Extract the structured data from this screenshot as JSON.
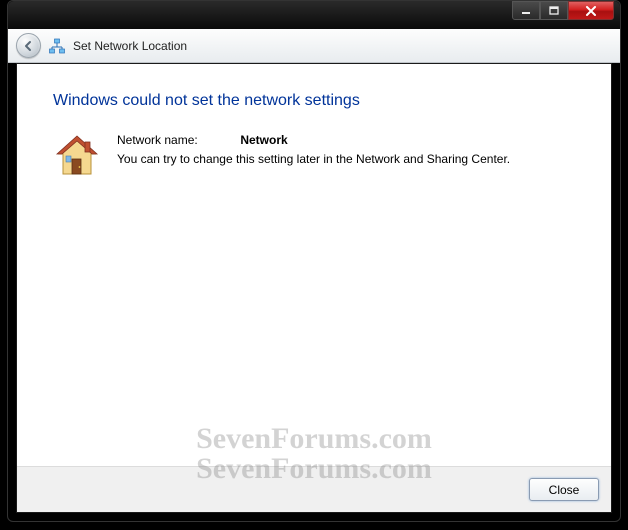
{
  "window": {
    "title": "Set Network Location"
  },
  "heading": "Windows could not set the network settings",
  "network": {
    "label": "Network name:",
    "value": "Network"
  },
  "message": "You can try to change this setting later in the Network and Sharing Center.",
  "buttons": {
    "close": "Close"
  },
  "watermark": "SevenForums.com"
}
